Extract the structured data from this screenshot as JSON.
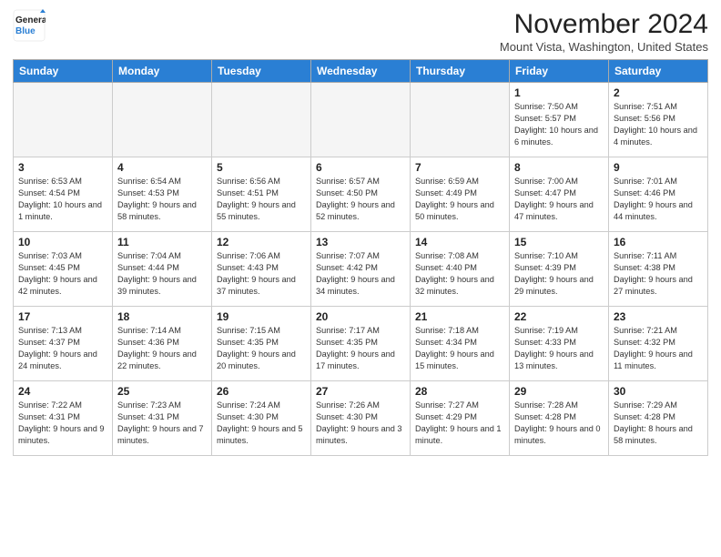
{
  "header": {
    "title": "November 2024",
    "location": "Mount Vista, Washington, United States",
    "logo_line1": "General",
    "logo_line2": "Blue"
  },
  "weekdays": [
    "Sunday",
    "Monday",
    "Tuesday",
    "Wednesday",
    "Thursday",
    "Friday",
    "Saturday"
  ],
  "weeks": [
    [
      {
        "day": "",
        "info": ""
      },
      {
        "day": "",
        "info": ""
      },
      {
        "day": "",
        "info": ""
      },
      {
        "day": "",
        "info": ""
      },
      {
        "day": "",
        "info": ""
      },
      {
        "day": "1",
        "info": "Sunrise: 7:50 AM\nSunset: 5:57 PM\nDaylight: 10 hours and 6 minutes."
      },
      {
        "day": "2",
        "info": "Sunrise: 7:51 AM\nSunset: 5:56 PM\nDaylight: 10 hours and 4 minutes."
      }
    ],
    [
      {
        "day": "3",
        "info": "Sunrise: 6:53 AM\nSunset: 4:54 PM\nDaylight: 10 hours and 1 minute."
      },
      {
        "day": "4",
        "info": "Sunrise: 6:54 AM\nSunset: 4:53 PM\nDaylight: 9 hours and 58 minutes."
      },
      {
        "day": "5",
        "info": "Sunrise: 6:56 AM\nSunset: 4:51 PM\nDaylight: 9 hours and 55 minutes."
      },
      {
        "day": "6",
        "info": "Sunrise: 6:57 AM\nSunset: 4:50 PM\nDaylight: 9 hours and 52 minutes."
      },
      {
        "day": "7",
        "info": "Sunrise: 6:59 AM\nSunset: 4:49 PM\nDaylight: 9 hours and 50 minutes."
      },
      {
        "day": "8",
        "info": "Sunrise: 7:00 AM\nSunset: 4:47 PM\nDaylight: 9 hours and 47 minutes."
      },
      {
        "day": "9",
        "info": "Sunrise: 7:01 AM\nSunset: 4:46 PM\nDaylight: 9 hours and 44 minutes."
      }
    ],
    [
      {
        "day": "10",
        "info": "Sunrise: 7:03 AM\nSunset: 4:45 PM\nDaylight: 9 hours and 42 minutes."
      },
      {
        "day": "11",
        "info": "Sunrise: 7:04 AM\nSunset: 4:44 PM\nDaylight: 9 hours and 39 minutes."
      },
      {
        "day": "12",
        "info": "Sunrise: 7:06 AM\nSunset: 4:43 PM\nDaylight: 9 hours and 37 minutes."
      },
      {
        "day": "13",
        "info": "Sunrise: 7:07 AM\nSunset: 4:42 PM\nDaylight: 9 hours and 34 minutes."
      },
      {
        "day": "14",
        "info": "Sunrise: 7:08 AM\nSunset: 4:40 PM\nDaylight: 9 hours and 32 minutes."
      },
      {
        "day": "15",
        "info": "Sunrise: 7:10 AM\nSunset: 4:39 PM\nDaylight: 9 hours and 29 minutes."
      },
      {
        "day": "16",
        "info": "Sunrise: 7:11 AM\nSunset: 4:38 PM\nDaylight: 9 hours and 27 minutes."
      }
    ],
    [
      {
        "day": "17",
        "info": "Sunrise: 7:13 AM\nSunset: 4:37 PM\nDaylight: 9 hours and 24 minutes."
      },
      {
        "day": "18",
        "info": "Sunrise: 7:14 AM\nSunset: 4:36 PM\nDaylight: 9 hours and 22 minutes."
      },
      {
        "day": "19",
        "info": "Sunrise: 7:15 AM\nSunset: 4:35 PM\nDaylight: 9 hours and 20 minutes."
      },
      {
        "day": "20",
        "info": "Sunrise: 7:17 AM\nSunset: 4:35 PM\nDaylight: 9 hours and 17 minutes."
      },
      {
        "day": "21",
        "info": "Sunrise: 7:18 AM\nSunset: 4:34 PM\nDaylight: 9 hours and 15 minutes."
      },
      {
        "day": "22",
        "info": "Sunrise: 7:19 AM\nSunset: 4:33 PM\nDaylight: 9 hours and 13 minutes."
      },
      {
        "day": "23",
        "info": "Sunrise: 7:21 AM\nSunset: 4:32 PM\nDaylight: 9 hours and 11 minutes."
      }
    ],
    [
      {
        "day": "24",
        "info": "Sunrise: 7:22 AM\nSunset: 4:31 PM\nDaylight: 9 hours and 9 minutes."
      },
      {
        "day": "25",
        "info": "Sunrise: 7:23 AM\nSunset: 4:31 PM\nDaylight: 9 hours and 7 minutes."
      },
      {
        "day": "26",
        "info": "Sunrise: 7:24 AM\nSunset: 4:30 PM\nDaylight: 9 hours and 5 minutes."
      },
      {
        "day": "27",
        "info": "Sunrise: 7:26 AM\nSunset: 4:30 PM\nDaylight: 9 hours and 3 minutes."
      },
      {
        "day": "28",
        "info": "Sunrise: 7:27 AM\nSunset: 4:29 PM\nDaylight: 9 hours and 1 minute."
      },
      {
        "day": "29",
        "info": "Sunrise: 7:28 AM\nSunset: 4:28 PM\nDaylight: 9 hours and 0 minutes."
      },
      {
        "day": "30",
        "info": "Sunrise: 7:29 AM\nSunset: 4:28 PM\nDaylight: 8 hours and 58 minutes."
      }
    ]
  ]
}
